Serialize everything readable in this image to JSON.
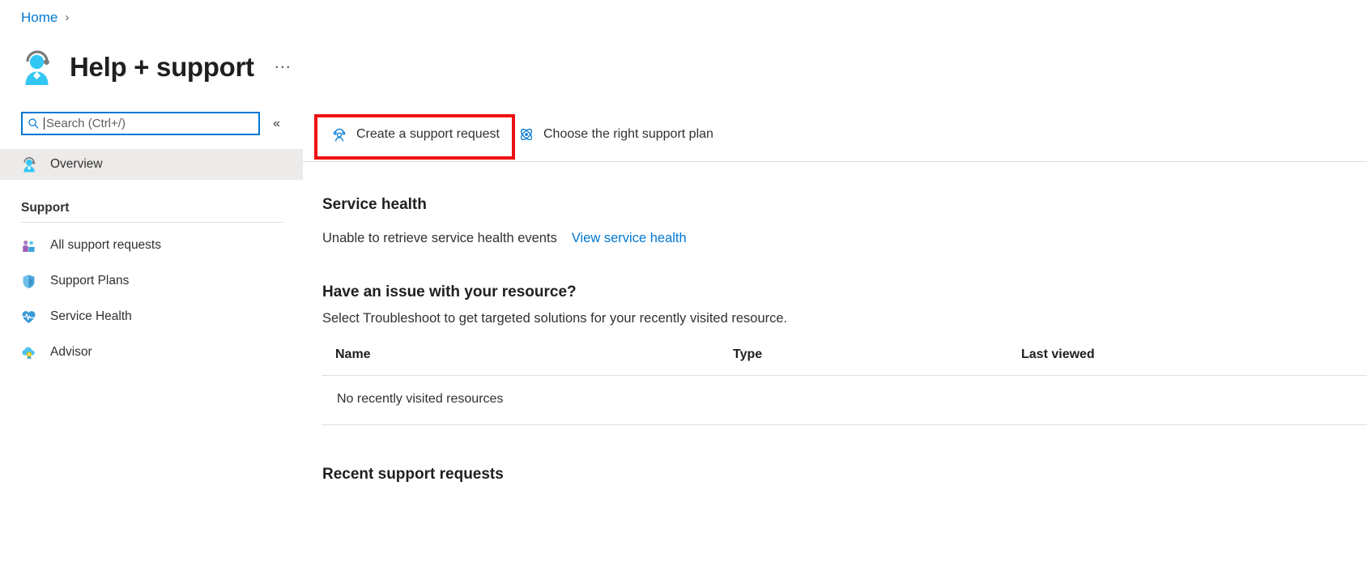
{
  "breadcrumb": {
    "home_label": "Home",
    "separator": "›"
  },
  "header": {
    "title": "Help + support",
    "icon": "support-person-icon",
    "more_label": "…"
  },
  "search": {
    "placeholder": "Search (Ctrl+/)",
    "value": "",
    "icon": "search-icon"
  },
  "sidebar": {
    "collapse_label": "«",
    "selected_item": "Overview",
    "top_items": [
      {
        "label": "Overview",
        "icon": "support-person-icon",
        "selected": true
      }
    ],
    "group_title": "Support",
    "items": [
      {
        "label": "All support requests",
        "icon": "support-requests-icon"
      },
      {
        "label": "Support Plans",
        "icon": "shield-icon"
      },
      {
        "label": "Service Health",
        "icon": "heart-pulse-icon"
      },
      {
        "label": "Advisor",
        "icon": "advisor-cloud-icon"
      }
    ]
  },
  "command_bar": {
    "items": [
      {
        "label": "Create a support request",
        "icon": "create-support-request-icon",
        "highlighted": true
      },
      {
        "label": "Choose the right support plan",
        "icon": "support-plan-atom-icon",
        "highlighted": false
      }
    ]
  },
  "main": {
    "service_health": {
      "heading": "Service health",
      "status_text": "Unable to retrieve service health events",
      "link_label": "View service health"
    },
    "resource_issue": {
      "heading": "Have an issue with your resource?",
      "subtitle": "Select Troubleshoot to get targeted solutions for your recently visited resource.",
      "table": {
        "columns": [
          "Name",
          "Type",
          "Last viewed"
        ],
        "rows": [],
        "empty_message": "No recently visited resources"
      }
    },
    "recent_support_requests": {
      "heading": "Recent support requests"
    }
  },
  "colors": {
    "accent": "#0078d4",
    "highlight": "#ee1111",
    "selected_row": "#edebe9",
    "divider": "#e1dfdd"
  }
}
